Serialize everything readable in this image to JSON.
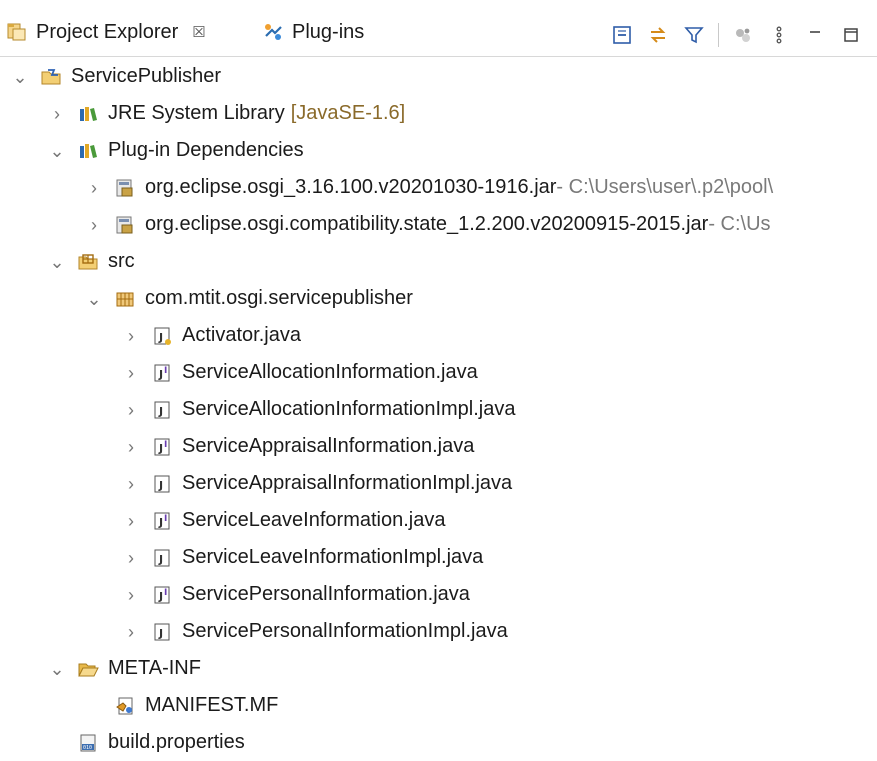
{
  "window": {
    "tabs": [
      {
        "label": "Project Explorer",
        "close": "☒",
        "icon": "project-explorer-icon"
      },
      {
        "label": "Plug-ins",
        "icon": "plugins-icon"
      }
    ],
    "toolbar": [
      "collapse-all-icon",
      "link-with-editor-icon",
      "filter-icon",
      "focus-icon",
      "view-menu-icon",
      "minimize-icon",
      "maximize-icon"
    ]
  },
  "tree": {
    "project": "ServicePublisher",
    "jre": {
      "label": "JRE System Library",
      "decoration": "[JavaSE-1.6]"
    },
    "plugin_deps": "Plug-in Dependencies",
    "jars": [
      {
        "label": "org.eclipse.osgi_3.16.100.v20201030-1916.jar",
        "path": " - C:\\Users\\user\\.p2\\pool\\"
      },
      {
        "label": "org.eclipse.osgi.compatibility.state_1.2.200.v20200915-2015.jar",
        "path": " - C:\\Us"
      }
    ],
    "src": "src",
    "package": "com.mtit.osgi.servicepublisher",
    "files": [
      {
        "label": "Activator.java",
        "kind": "class"
      },
      {
        "label": "ServiceAllocationInformation.java",
        "kind": "interface"
      },
      {
        "label": "ServiceAllocationInformationImpl.java",
        "kind": "class"
      },
      {
        "label": "ServiceAppraisalInformation.java",
        "kind": "interface"
      },
      {
        "label": "ServiceAppraisalInformationImpl.java",
        "kind": "class"
      },
      {
        "label": "ServiceLeaveInformation.java",
        "kind": "interface"
      },
      {
        "label": "ServiceLeaveInformationImpl.java",
        "kind": "class"
      },
      {
        "label": "ServicePersonalInformation.java",
        "kind": "interface"
      },
      {
        "label": "ServicePersonalInformationImpl.java",
        "kind": "class"
      }
    ],
    "metainf": "META-INF",
    "manifest": "MANIFEST.MF",
    "build": "build.properties"
  }
}
